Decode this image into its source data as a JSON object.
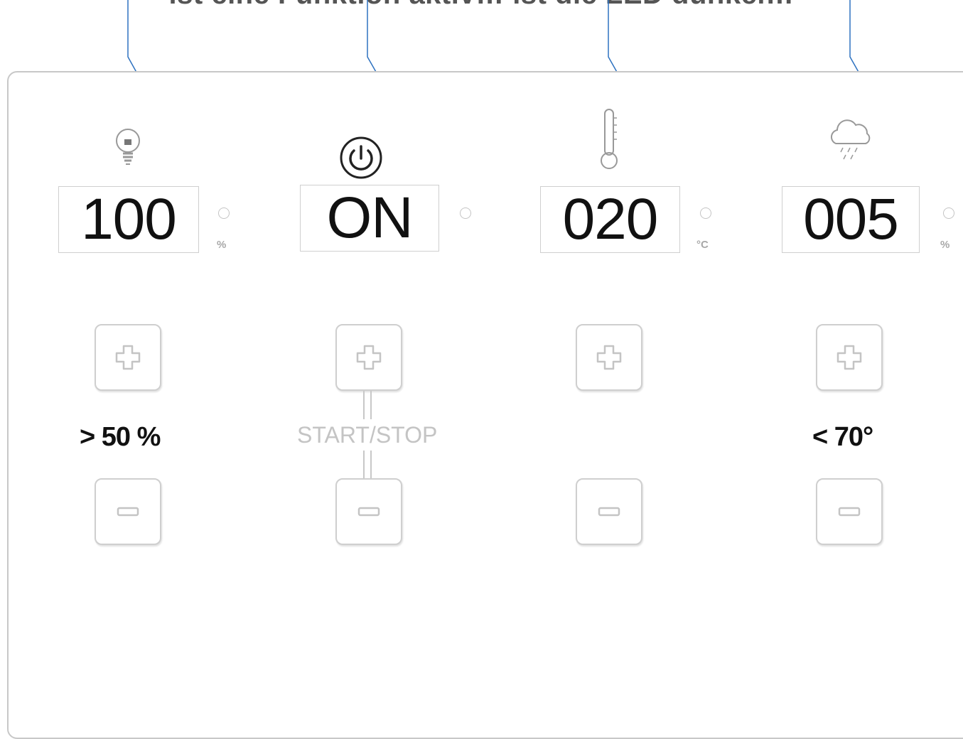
{
  "caption": "ist eine Funktion aktiv… ist die LED dunkel…",
  "channels": [
    {
      "icon": "light-bulb-icon",
      "display": "100",
      "unit": "%"
    },
    {
      "icon": "power-icon",
      "display": "ON",
      "unit": ""
    },
    {
      "icon": "thermometer-icon",
      "display": "020",
      "unit": "°C"
    },
    {
      "icon": "rain-cloud-icon",
      "display": "005",
      "unit": "%"
    }
  ],
  "notes": {
    "channel1": "> 50 %",
    "channel2": "START/STOP",
    "channel4": "< 70°"
  },
  "colors": {
    "arrow": "#2e72c0",
    "outline": "#c8c8c8",
    "text": "#111111"
  }
}
